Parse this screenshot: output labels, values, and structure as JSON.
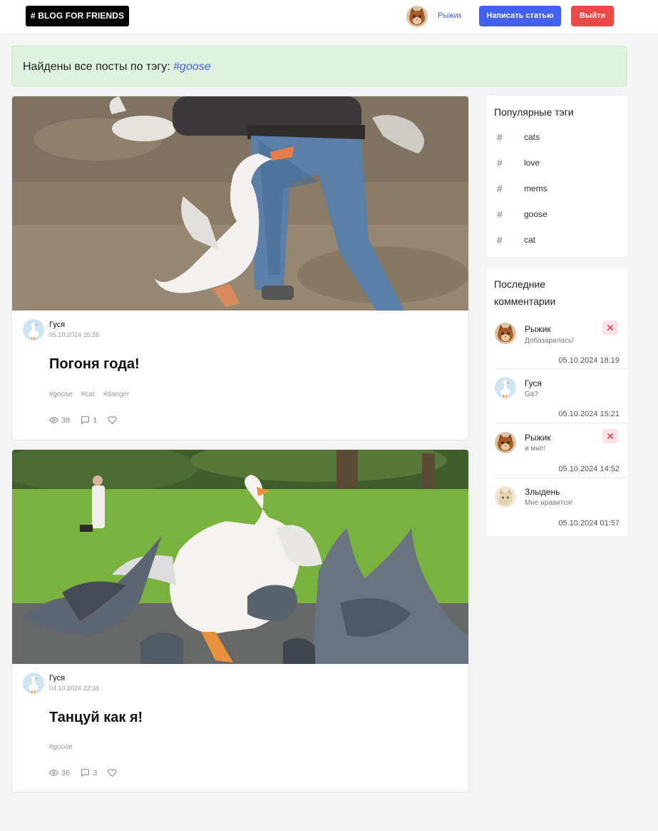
{
  "header": {
    "logo": "# BLOG FOR FRIENDS",
    "user_name": "Рыжик",
    "write_label": "Написать статью",
    "logout_label": "Выйти"
  },
  "banner": {
    "text": "Найдены все посты по тэгу:",
    "tag": "#goose"
  },
  "posts": [
    {
      "author": "Гуся",
      "date": "05.10.2024 15:26",
      "title": "Погоня года!",
      "tags": [
        "#goose",
        "#cat",
        "#danger"
      ],
      "views": "38",
      "comments": "1"
    },
    {
      "author": "Гуся",
      "date": "04.10.2024 22:34",
      "title": "Танцуй как я!",
      "tags": [
        "#goose"
      ],
      "views": "36",
      "comments": "3"
    }
  ],
  "popular_tags": {
    "title": "Популярные тэги",
    "items": [
      "cats",
      "love",
      "mems",
      "goose",
      "cat"
    ]
  },
  "recent_comments": {
    "title_line1": "Последние",
    "title_line2": "комментарии",
    "items": [
      {
        "name": "Рыжик",
        "text": "Добазарилась!",
        "date": "05.10.2024 18:19",
        "delete": "✕"
      },
      {
        "name": "Гуся",
        "text": "Ga?",
        "date": "05.10.2024 15:21"
      },
      {
        "name": "Рыжик",
        "text": "и мне!",
        "date": "05.10.2024 14:52",
        "delete": "✕"
      },
      {
        "name": "Злыдень",
        "text": "Мне нравится!",
        "date": "05.10.2024 01:57"
      }
    ]
  },
  "colors": {
    "accent": "#4361ee",
    "danger": "#ef4848",
    "banner_bg": "#dff1e0",
    "page_bg": "#f4f4f4"
  }
}
